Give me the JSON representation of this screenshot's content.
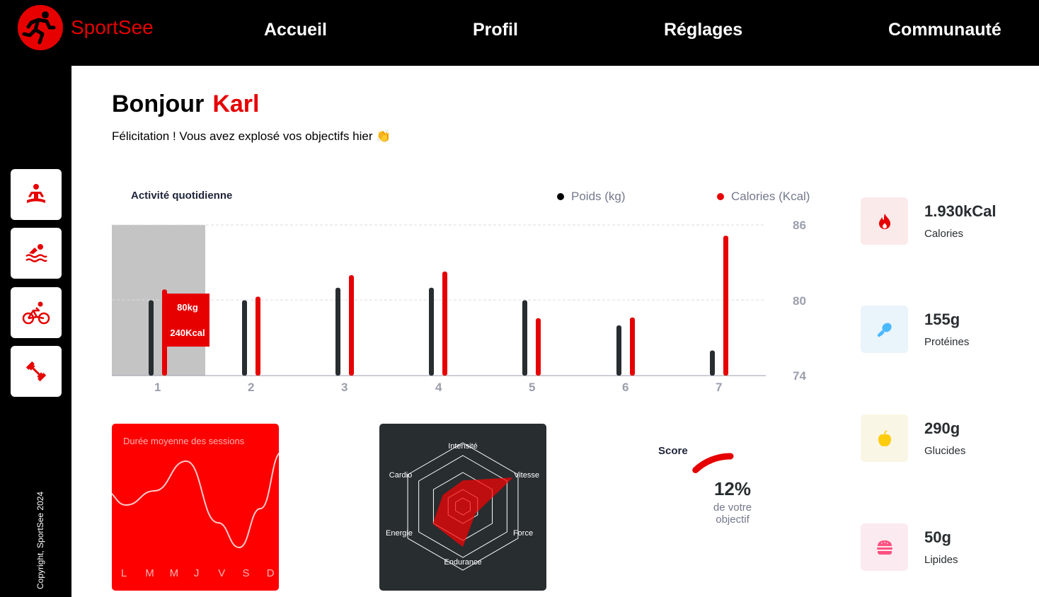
{
  "app": {
    "name": "SportSee"
  },
  "nav": {
    "home": "Accueil",
    "profile": "Profil",
    "settings": "Réglages",
    "community": "Communauté"
  },
  "sidebar": {
    "items": [
      "yoga-icon",
      "swim-icon",
      "bike-icon",
      "dumbbell-icon"
    ],
    "copyright": "Copyright, SportSee 2024"
  },
  "greeting": {
    "hello": "Bonjour",
    "name": "Karl",
    "message": "Félicitation ! Vous avez explosé vos objectifs hier 👏"
  },
  "activity": {
    "title": "Activité quotidienne",
    "legend_weight": "Poids (kg)",
    "legend_calories": "Calories (Kcal)",
    "tooltip_weight": "80kg",
    "tooltip_calories": "240Kcal",
    "y_ticks": [
      "86",
      "80",
      "74"
    ],
    "x_ticks": [
      "1",
      "2",
      "3",
      "4",
      "5",
      "6",
      "7"
    ]
  },
  "sessions": {
    "title": "Durée moyenne des sessions",
    "days": [
      "L",
      "M",
      "M",
      "J",
      "V",
      "S",
      "D"
    ]
  },
  "performance": {
    "labels": [
      "Intensité",
      "Vitesse",
      "Force",
      "Endurance",
      "Energie",
      "Cardio"
    ]
  },
  "score": {
    "title": "Score",
    "value": "12%",
    "line1": "de votre",
    "line2": "objectif",
    "fraction": 0.12
  },
  "stats": {
    "calories": {
      "value": "1.930kCal",
      "label": "Calories"
    },
    "proteins": {
      "value": "155g",
      "label": "Protéines"
    },
    "carbs": {
      "value": "290g",
      "label": "Glucides"
    },
    "lipids": {
      "value": "50g",
      "label": "Lipides"
    }
  },
  "colors": {
    "accent": "#e60000",
    "dark": "#282d30",
    "weight_bar": "#282d30",
    "calories_bar": "#e60000"
  },
  "chart_data": [
    {
      "type": "bar",
      "title": "Activité quotidienne",
      "categories": [
        "1",
        "2",
        "3",
        "4",
        "5",
        "6",
        "7"
      ],
      "series": [
        {
          "name": "Poids (kg)",
          "values": [
            80,
            80,
            81,
            81,
            80,
            78,
            76
          ]
        },
        {
          "name": "Calories (Kcal)",
          "values": [
            240,
            220,
            280,
            290,
            160,
            162,
            390
          ]
        }
      ],
      "ylim": [
        74,
        86
      ],
      "y_ticks": [
        74,
        80,
        86
      ],
      "grid": true,
      "legend": "top-right"
    },
    {
      "type": "line",
      "title": "Durée moyenne des sessions",
      "categories": [
        "L",
        "M",
        "M",
        "J",
        "V",
        "S",
        "D"
      ],
      "values": [
        30,
        23,
        45,
        50,
        0,
        0,
        60
      ]
    },
    {
      "type": "radar",
      "categories": [
        "Intensité",
        "Vitesse",
        "Force",
        "Endurance",
        "Energie",
        "Cardio"
      ],
      "values": [
        90,
        200,
        50,
        140,
        120,
        80
      ],
      "rmax": 220
    },
    {
      "type": "pie",
      "title": "Score",
      "values": [
        12
      ]
    }
  ]
}
